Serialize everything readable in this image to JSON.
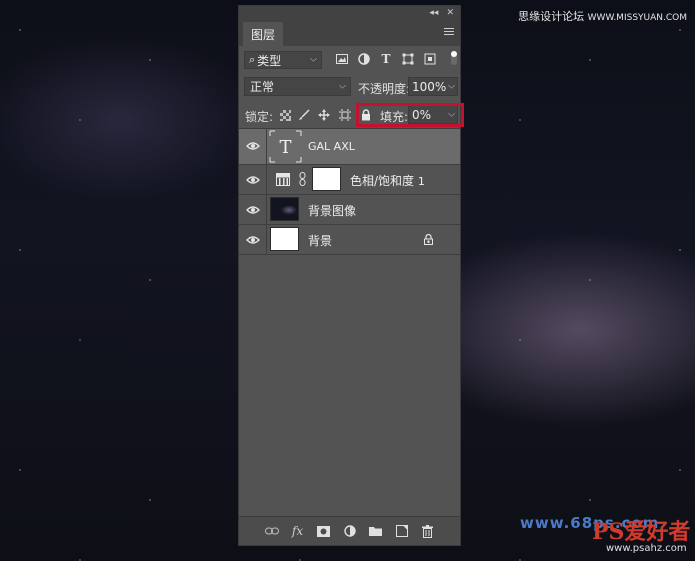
{
  "watermark": {
    "top_text": "思缘设计论坛",
    "top_url": "WWW.MISSYUAN.COM",
    "bottom_url": "www.68ps.com",
    "logo_text": "PS爱好者",
    "logo_url": "www.psahz.com"
  },
  "panel": {
    "tab_label": "图层",
    "collapse_icon": "double-chevron",
    "close_icon": "x",
    "menu_icon": "hamburger"
  },
  "filter": {
    "kind_value": "类型",
    "icons": [
      "image-filter-icon",
      "adjustment-filter-icon",
      "type-filter-icon",
      "shape-filter-icon",
      "smart-object-filter-icon"
    ]
  },
  "blend": {
    "mode_value": "正常",
    "opacity_label": "不透明度:",
    "opacity_value": "100%"
  },
  "lock": {
    "label": "锁定:",
    "fill_label": "填充:",
    "fill_value": "0%",
    "highlight_color": "#c8102e"
  },
  "layers": [
    {
      "name": "GAL AXL",
      "type": "text",
      "selected": true,
      "visible": true
    },
    {
      "name": "色相/饱和度",
      "number": "1",
      "type": "adjustment",
      "selected": false,
      "visible": true
    },
    {
      "name": "背景图像",
      "type": "image",
      "selected": false,
      "visible": true
    },
    {
      "name": "背景",
      "type": "background",
      "locked": true,
      "selected": false,
      "visible": true
    }
  ],
  "bottom_icons": [
    "link-icon",
    "fx-icon",
    "mask-icon",
    "adjustment-layer-icon",
    "group-icon",
    "new-layer-icon",
    "delete-icon"
  ],
  "fx_label": "fx"
}
